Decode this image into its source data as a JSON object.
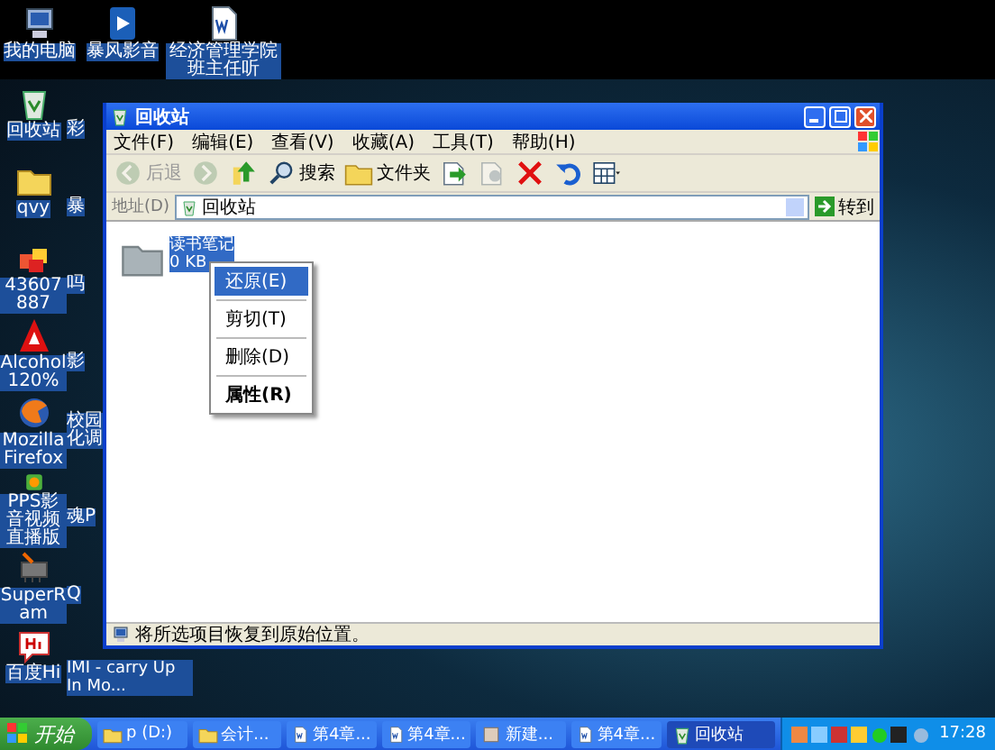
{
  "desktop": {
    "top_row": [
      {
        "label": "我的电脑",
        "kind": "computer"
      },
      {
        "label": "暴风影音",
        "kind": "media"
      },
      {
        "label": "经济管理学院班主任听",
        "kind": "document"
      }
    ],
    "column_1": [
      {
        "label": "回收站",
        "kind": "recycle"
      },
      {
        "label": "qvy",
        "kind": "folder"
      },
      {
        "label": "43607887",
        "kind": "cubes"
      },
      {
        "label": "Alcohol 120%",
        "kind": "alcohol"
      },
      {
        "label": "Mozilla Firefox",
        "kind": "globe"
      },
      {
        "label": "PPS影音视频直播版",
        "kind": "pps"
      },
      {
        "label": "SuperRam",
        "kind": "chip"
      },
      {
        "label": "百度Hi",
        "kind": "chat"
      }
    ],
    "column_2": [
      "彩",
      "暴",
      "吗",
      "影",
      "校园化调",
      "魂P",
      "Q",
      "IMI - carry Up In Mo..."
    ]
  },
  "window": {
    "title": "回收站",
    "menu": [
      "文件(F)",
      "编辑(E)",
      "查看(V)",
      "收藏(A)",
      "工具(T)",
      "帮助(H)"
    ],
    "toolbar": [
      {
        "kind": "back",
        "label": "后退",
        "disabled": true
      },
      {
        "kind": "forward",
        "disabled": true
      },
      {
        "kind": "up",
        "disabled": false
      },
      {
        "kind": "search",
        "label": "搜索",
        "disabled": false
      },
      {
        "kind": "folders",
        "label": "文件夹",
        "disabled": false
      },
      {
        "kind": "move",
        "disabled": false
      },
      {
        "kind": "copy",
        "disabled": true
      },
      {
        "kind": "delete",
        "disabled": false
      },
      {
        "kind": "undo",
        "disabled": false
      },
      {
        "kind": "views",
        "disabled": false
      }
    ],
    "address": {
      "label": "地址(D)",
      "value": "回收站",
      "go": "转到"
    },
    "files": [
      {
        "name": "读书笔记",
        "size": "0 KB",
        "selected": true
      }
    ],
    "context_menu": [
      [
        {
          "label": "还原(E)",
          "selected": true,
          "default": false
        }
      ],
      [
        {
          "label": "剪切(T)",
          "selected": false,
          "default": false
        }
      ],
      [
        {
          "label": "删除(D)",
          "selected": false,
          "default": false
        }
      ],
      [
        {
          "label": "属性(R)",
          "selected": false,
          "default": true
        }
      ]
    ],
    "status_bar": "将所选项目恢复到原始位置。"
  },
  "taskbar": {
    "start": "开始",
    "tasks": [
      {
        "label": "p (D:)",
        "kind": "folder",
        "selected": false
      },
      {
        "label": "会计...",
        "kind": "folder",
        "selected": false
      },
      {
        "label": "第4章...",
        "kind": "document",
        "selected": false
      },
      {
        "label": "第4章...",
        "kind": "document",
        "selected": false
      },
      {
        "label": "新建...",
        "kind": "app",
        "selected": false
      },
      {
        "label": "第4章...",
        "kind": "document",
        "selected": false
      },
      {
        "label": "回收站",
        "kind": "recycle",
        "selected": true
      }
    ],
    "clock": "17:28"
  }
}
